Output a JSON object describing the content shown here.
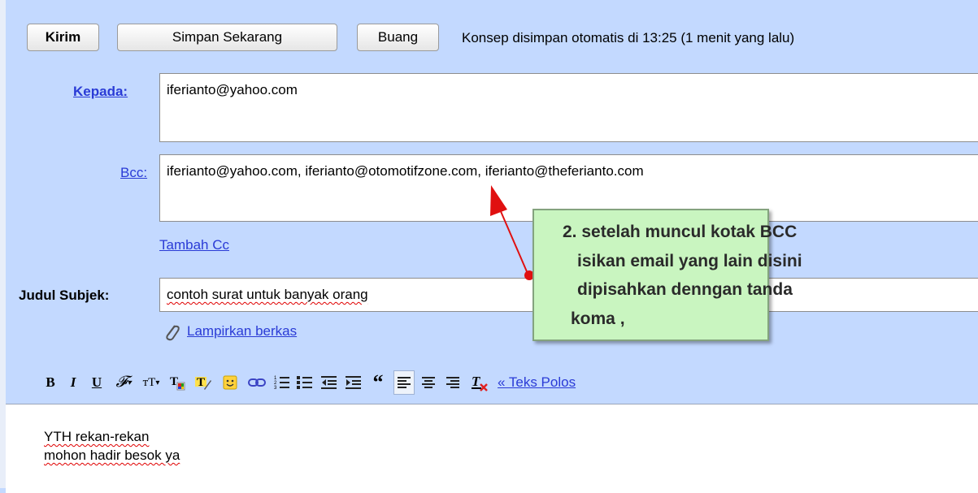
{
  "toolbar": {
    "send_label": "Kirim",
    "save_now_label": "Simpan Sekarang",
    "discard_label": "Buang",
    "autosave_status": "Konsep disimpan otomatis di 13:25 (1 menit yang lalu)"
  },
  "to_field": {
    "label": "Kepada:",
    "value": "iferianto@yahoo.com"
  },
  "bcc_field": {
    "label": "Bcc:",
    "value": "iferianto@yahoo.com, iferianto@otomotifzone.com, iferianto@theferianto.com"
  },
  "add_cc_label": "Tambah Cc",
  "subject_field": {
    "label": "Judul Subjek:",
    "value": "contoh surat untuk banyak orang"
  },
  "attach_label": "Lampirkan berkas",
  "format_toolbar": {
    "bold": "B",
    "italic": "I",
    "underline": "U",
    "plain_text_label": "« Teks Polos",
    "icons": [
      "bold-icon",
      "italic-icon",
      "underline-icon",
      "font-icon",
      "text-size-icon",
      "text-color-icon",
      "highlight-icon",
      "emoticon-icon",
      "link-icon",
      "numbered-list-icon",
      "bullet-list-icon",
      "indent-less-icon",
      "indent-more-icon",
      "quote-icon",
      "align-left-icon",
      "align-center-icon",
      "align-right-icon",
      "remove-formatting-icon"
    ]
  },
  "body": {
    "line1": "YTH rekan-rekan",
    "line2": "mohon hadir besok ya"
  },
  "annotation": {
    "line1": "2. setelah muncul kotak BCC",
    "line2": "isikan email yang lain disini",
    "line3": "dipisahkan denngan tanda",
    "line4": "koma  ,"
  },
  "colors": {
    "background": "#c3d9ff",
    "link": "#2a3bd6",
    "callout_fill": "#c9f5c0",
    "arrow": "#e01010"
  }
}
